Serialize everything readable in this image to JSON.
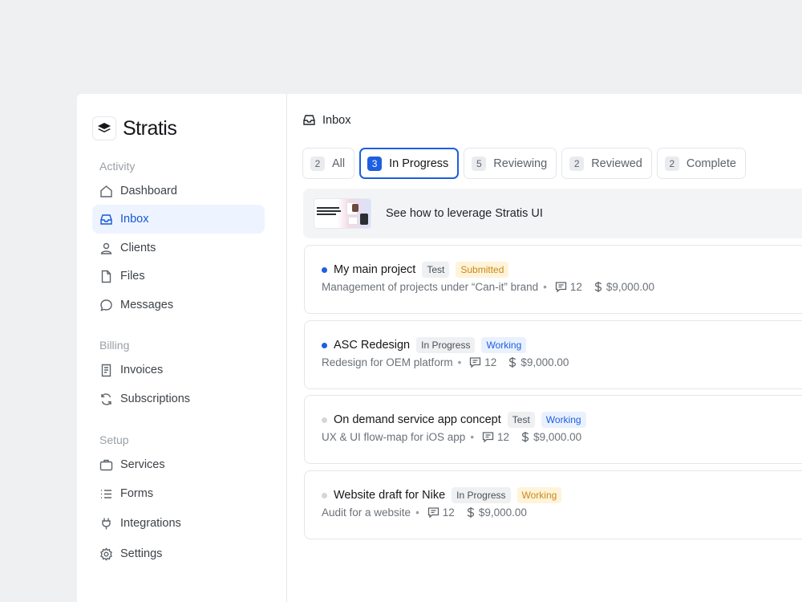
{
  "brand": {
    "name": "Stratis"
  },
  "sidebar": {
    "sections": [
      {
        "label": "Activity"
      },
      {
        "label": "Billing"
      },
      {
        "label": "Setup"
      }
    ],
    "items": [
      {
        "label": "Dashboard",
        "icon": "home-icon"
      },
      {
        "label": "Inbox",
        "icon": "inbox-icon",
        "active": true
      },
      {
        "label": "Clients",
        "icon": "user-icon"
      },
      {
        "label": "Files",
        "icon": "file-icon"
      },
      {
        "label": "Messages",
        "icon": "message-icon"
      },
      {
        "label": "Invoices",
        "icon": "receipt-icon"
      },
      {
        "label": "Subscriptions",
        "icon": "refresh-icon"
      },
      {
        "label": "Services",
        "icon": "briefcase-icon"
      },
      {
        "label": "Forms",
        "icon": "list-icon"
      },
      {
        "label": "Integrations",
        "icon": "plug-icon"
      },
      {
        "label": "Settings",
        "icon": "gear-icon"
      }
    ]
  },
  "header": {
    "title": "Inbox",
    "icon": "inbox-icon"
  },
  "tabs": [
    {
      "count": "2",
      "label": "All"
    },
    {
      "count": "3",
      "label": "In Progress",
      "active": true
    },
    {
      "count": "5",
      "label": "Reviewing"
    },
    {
      "count": "2",
      "label": "Reviewed"
    },
    {
      "count": "2",
      "label": "Complete"
    }
  ],
  "promo": {
    "text": "See how to leverage Stratis UI"
  },
  "projects": [
    {
      "title": "My main project",
      "tags": [
        {
          "label": "Test",
          "bg": "#eef0f2",
          "fg": "#4b5157"
        },
        {
          "label": "Submitted",
          "bg": "#fff3da",
          "fg": "#c98a14"
        }
      ],
      "description": "Management of projects under “Can-it” brand",
      "comments": "12",
      "amount": "$9,000.00",
      "dot_color": "#1d5fe0"
    },
    {
      "title": "ASC Redesign",
      "tags": [
        {
          "label": "In Progress",
          "bg": "#eef0f2",
          "fg": "#4b5157"
        },
        {
          "label": "Working",
          "bg": "#eaf1fe",
          "fg": "#1d5fe0"
        }
      ],
      "description": "Redesign for OEM platform",
      "comments": "12",
      "amount": "$9,000.00",
      "dot_color": "#1d5fe0"
    },
    {
      "title": "On demand service app concept",
      "tags": [
        {
          "label": "Test",
          "bg": "#eef0f2",
          "fg": "#4b5157"
        },
        {
          "label": "Working",
          "bg": "#eaf1fe",
          "fg": "#1d5fe0"
        }
      ],
      "description": "UX & UI flow-map for iOS app",
      "comments": "12",
      "amount": "$9,000.00",
      "dot_color": "#d3d6da"
    },
    {
      "title": "Website draft for Nike",
      "tags": [
        {
          "label": "In Progress",
          "bg": "#eef0f2",
          "fg": "#4b5157"
        },
        {
          "label": "Working",
          "bg": "#fff3da",
          "fg": "#c98a14"
        }
      ],
      "description": "Audit for a website",
      "comments": "12",
      "amount": "$9,000.00",
      "dot_color": "#d3d6da"
    }
  ]
}
